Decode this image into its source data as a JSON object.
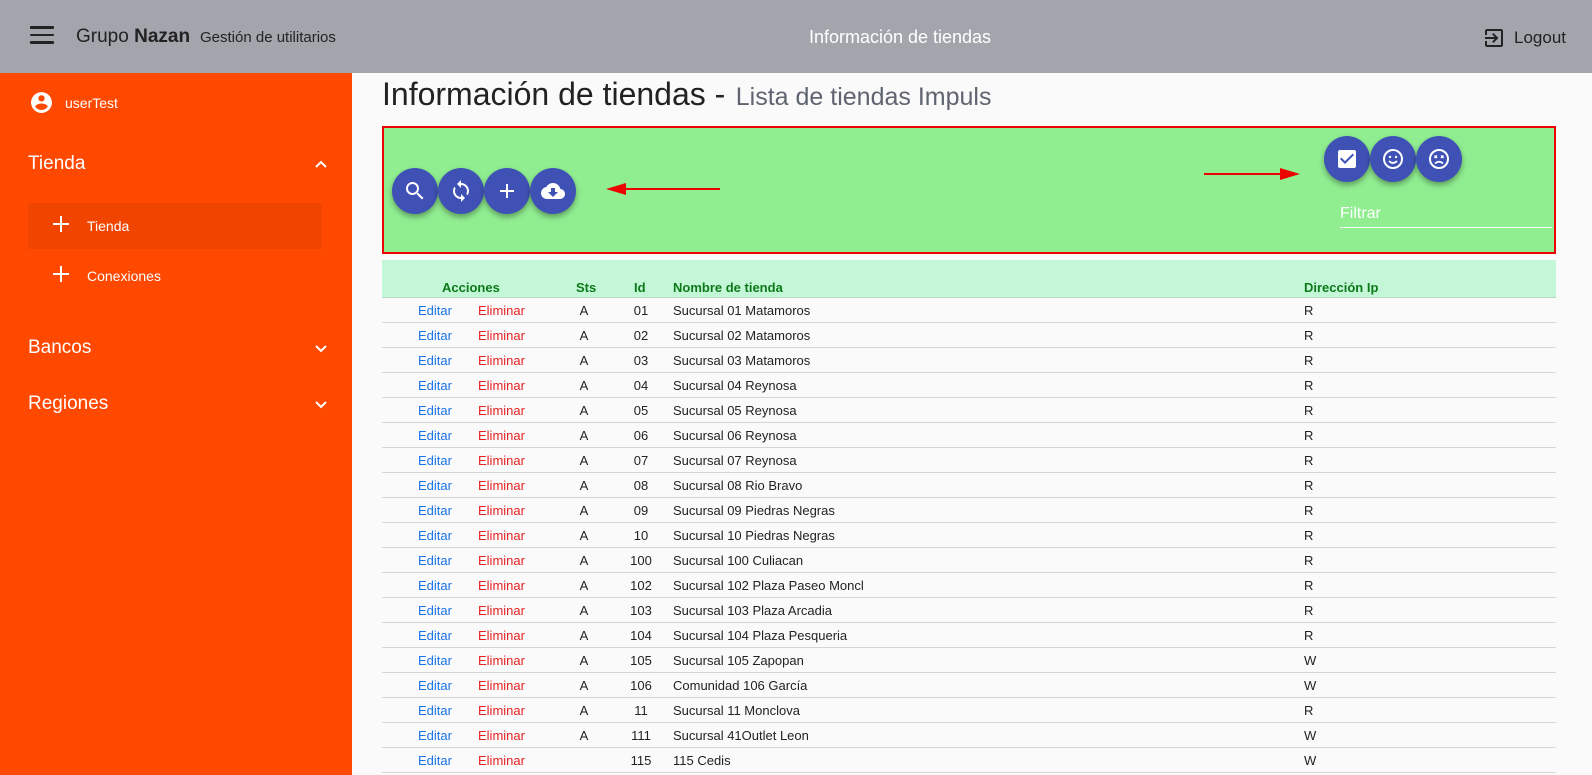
{
  "header": {
    "brand_prefix": "Grupo",
    "brand_bold": "Nazan",
    "subtitle": "Gestión de utilitarios",
    "title": "Información de tiendas",
    "logout_label": "Logout"
  },
  "sidebar": {
    "username": "userTest",
    "groups": [
      {
        "label": "Tienda",
        "expanded": true
      },
      {
        "label": "Bancos",
        "expanded": false
      },
      {
        "label": "Regiones",
        "expanded": false
      }
    ],
    "sub_items": [
      {
        "label": "Tienda",
        "active": true
      },
      {
        "label": "Conexiones",
        "active": false
      }
    ]
  },
  "page": {
    "title": "Información de tiendas -",
    "subtitle": "Lista de tiendas Impuls"
  },
  "toolbar": {
    "left_buttons": [
      "search-icon",
      "refresh-icon",
      "add-icon",
      "cloud-download-icon"
    ],
    "right_buttons": [
      "check-box-icon",
      "smile-icon",
      "sad-face-icon"
    ],
    "filter_placeholder": "Filtrar",
    "accent_color": "#3f51b5",
    "background_color": "#90ee90"
  },
  "table": {
    "headers": {
      "actions": "Acciones",
      "sts": "Sts",
      "id": "Id",
      "name": "Nombre de tienda",
      "ip": "Dirección Ip"
    },
    "edit_label": "Editar",
    "delete_label": "Eliminar",
    "rows": [
      {
        "sts": "A",
        "id": "01",
        "name": "Sucursal 01 Matamoros",
        "ip": "R"
      },
      {
        "sts": "A",
        "id": "02",
        "name": "Sucursal 02 Matamoros",
        "ip": "R"
      },
      {
        "sts": "A",
        "id": "03",
        "name": "Sucursal 03 Matamoros",
        "ip": "R"
      },
      {
        "sts": "A",
        "id": "04",
        "name": "Sucursal 04 Reynosa",
        "ip": "R"
      },
      {
        "sts": "A",
        "id": "05",
        "name": "Sucursal 05 Reynosa",
        "ip": "R"
      },
      {
        "sts": "A",
        "id": "06",
        "name": "Sucursal 06 Reynosa",
        "ip": "R"
      },
      {
        "sts": "A",
        "id": "07",
        "name": "Sucursal 07 Reynosa",
        "ip": "R"
      },
      {
        "sts": "A",
        "id": "08",
        "name": "Sucursal 08 Rio Bravo",
        "ip": "R"
      },
      {
        "sts": "A",
        "id": "09",
        "name": "Sucursal 09 Piedras Negras",
        "ip": "R"
      },
      {
        "sts": "A",
        "id": "10",
        "name": "Sucursal 10 Piedras Negras",
        "ip": "R"
      },
      {
        "sts": "A",
        "id": "100",
        "name": "Sucursal 100 Culiacan",
        "ip": "R"
      },
      {
        "sts": "A",
        "id": "102",
        "name": "Sucursal 102 Plaza Paseo Moncl",
        "ip": "R"
      },
      {
        "sts": "A",
        "id": "103",
        "name": "Sucursal 103 Plaza Arcadia",
        "ip": "R"
      },
      {
        "sts": "A",
        "id": "104",
        "name": "Sucursal 104 Plaza Pesqueria",
        "ip": "R"
      },
      {
        "sts": "A",
        "id": "105",
        "name": "Sucursal 105 Zapopan",
        "ip": "W"
      },
      {
        "sts": "A",
        "id": "106",
        "name": "Comunidad 106 García",
        "ip": "W"
      },
      {
        "sts": "A",
        "id": "11",
        "name": "Sucursal 11 Monclova",
        "ip": "R"
      },
      {
        "sts": "A",
        "id": "111",
        "name": "Sucursal 41Outlet Leon",
        "ip": "W"
      },
      {
        "sts": "",
        "id": "115",
        "name": "115 Cedis",
        "ip": "W"
      }
    ]
  }
}
